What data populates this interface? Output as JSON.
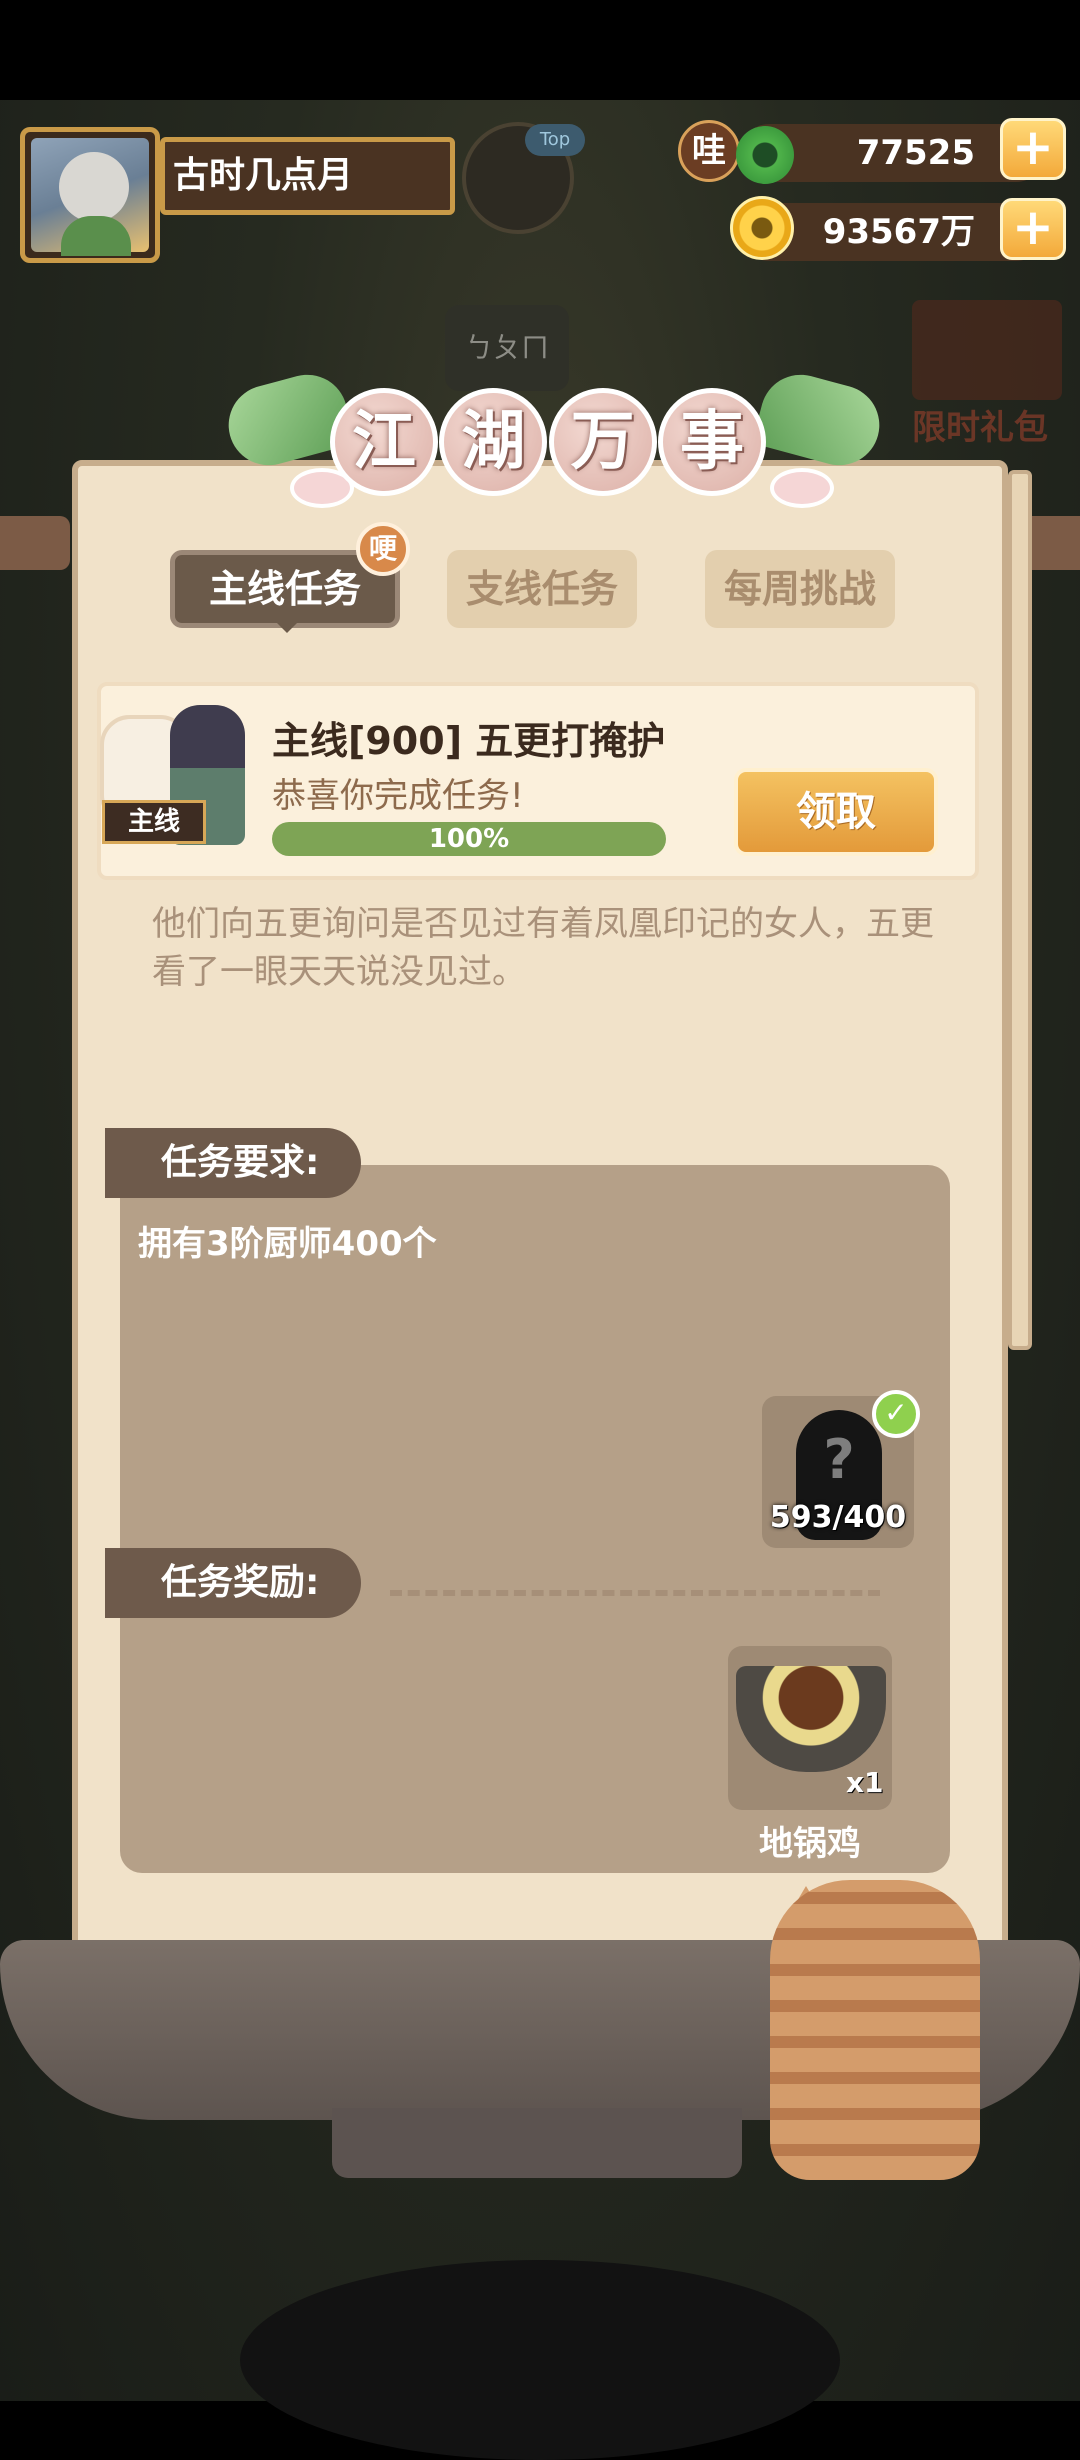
{
  "player": {
    "name": "古时几点月",
    "avatar_icon": "wolf-chef-avatar-icon"
  },
  "top_tag": "Top",
  "currencies": {
    "wa_badge": "哇",
    "jade": "77525",
    "coins": "93567万",
    "plus": "+"
  },
  "background": {
    "chip_text": "ㄅㄆㄇ",
    "limited_pack": "限时礼包"
  },
  "panel": {
    "title_chars": [
      "江",
      "湖",
      "万",
      "事"
    ],
    "tabs": [
      {
        "label": "主线任务",
        "active": true,
        "badge": "哽"
      },
      {
        "label": "支线任务",
        "active": false
      },
      {
        "label": "每周挑战",
        "active": false
      }
    ],
    "quest": {
      "tag": "主线",
      "title": "主线[900] 五更打掩护",
      "subtitle": "恭喜你完成任务!",
      "progress": "100%",
      "claim_label": "领取"
    },
    "description": "他们向五更询问是否见过有着凤凰印记的女人，五更看了一眼天天说没见过。",
    "requirements": {
      "label": "任务要求:",
      "text": "拥有3阶厨师400个",
      "slot_count": "593/400",
      "slot_symbol": "?",
      "check": "✓"
    },
    "rewards": {
      "label": "任务奖励:",
      "item_name": "地锅鸡",
      "item_qty": "x1"
    }
  },
  "colors": {
    "panel_bg": "#f1e2c9",
    "tab_active": "#6b5a4a",
    "claim": "#e39a3a",
    "progress": "#7ea455"
  }
}
